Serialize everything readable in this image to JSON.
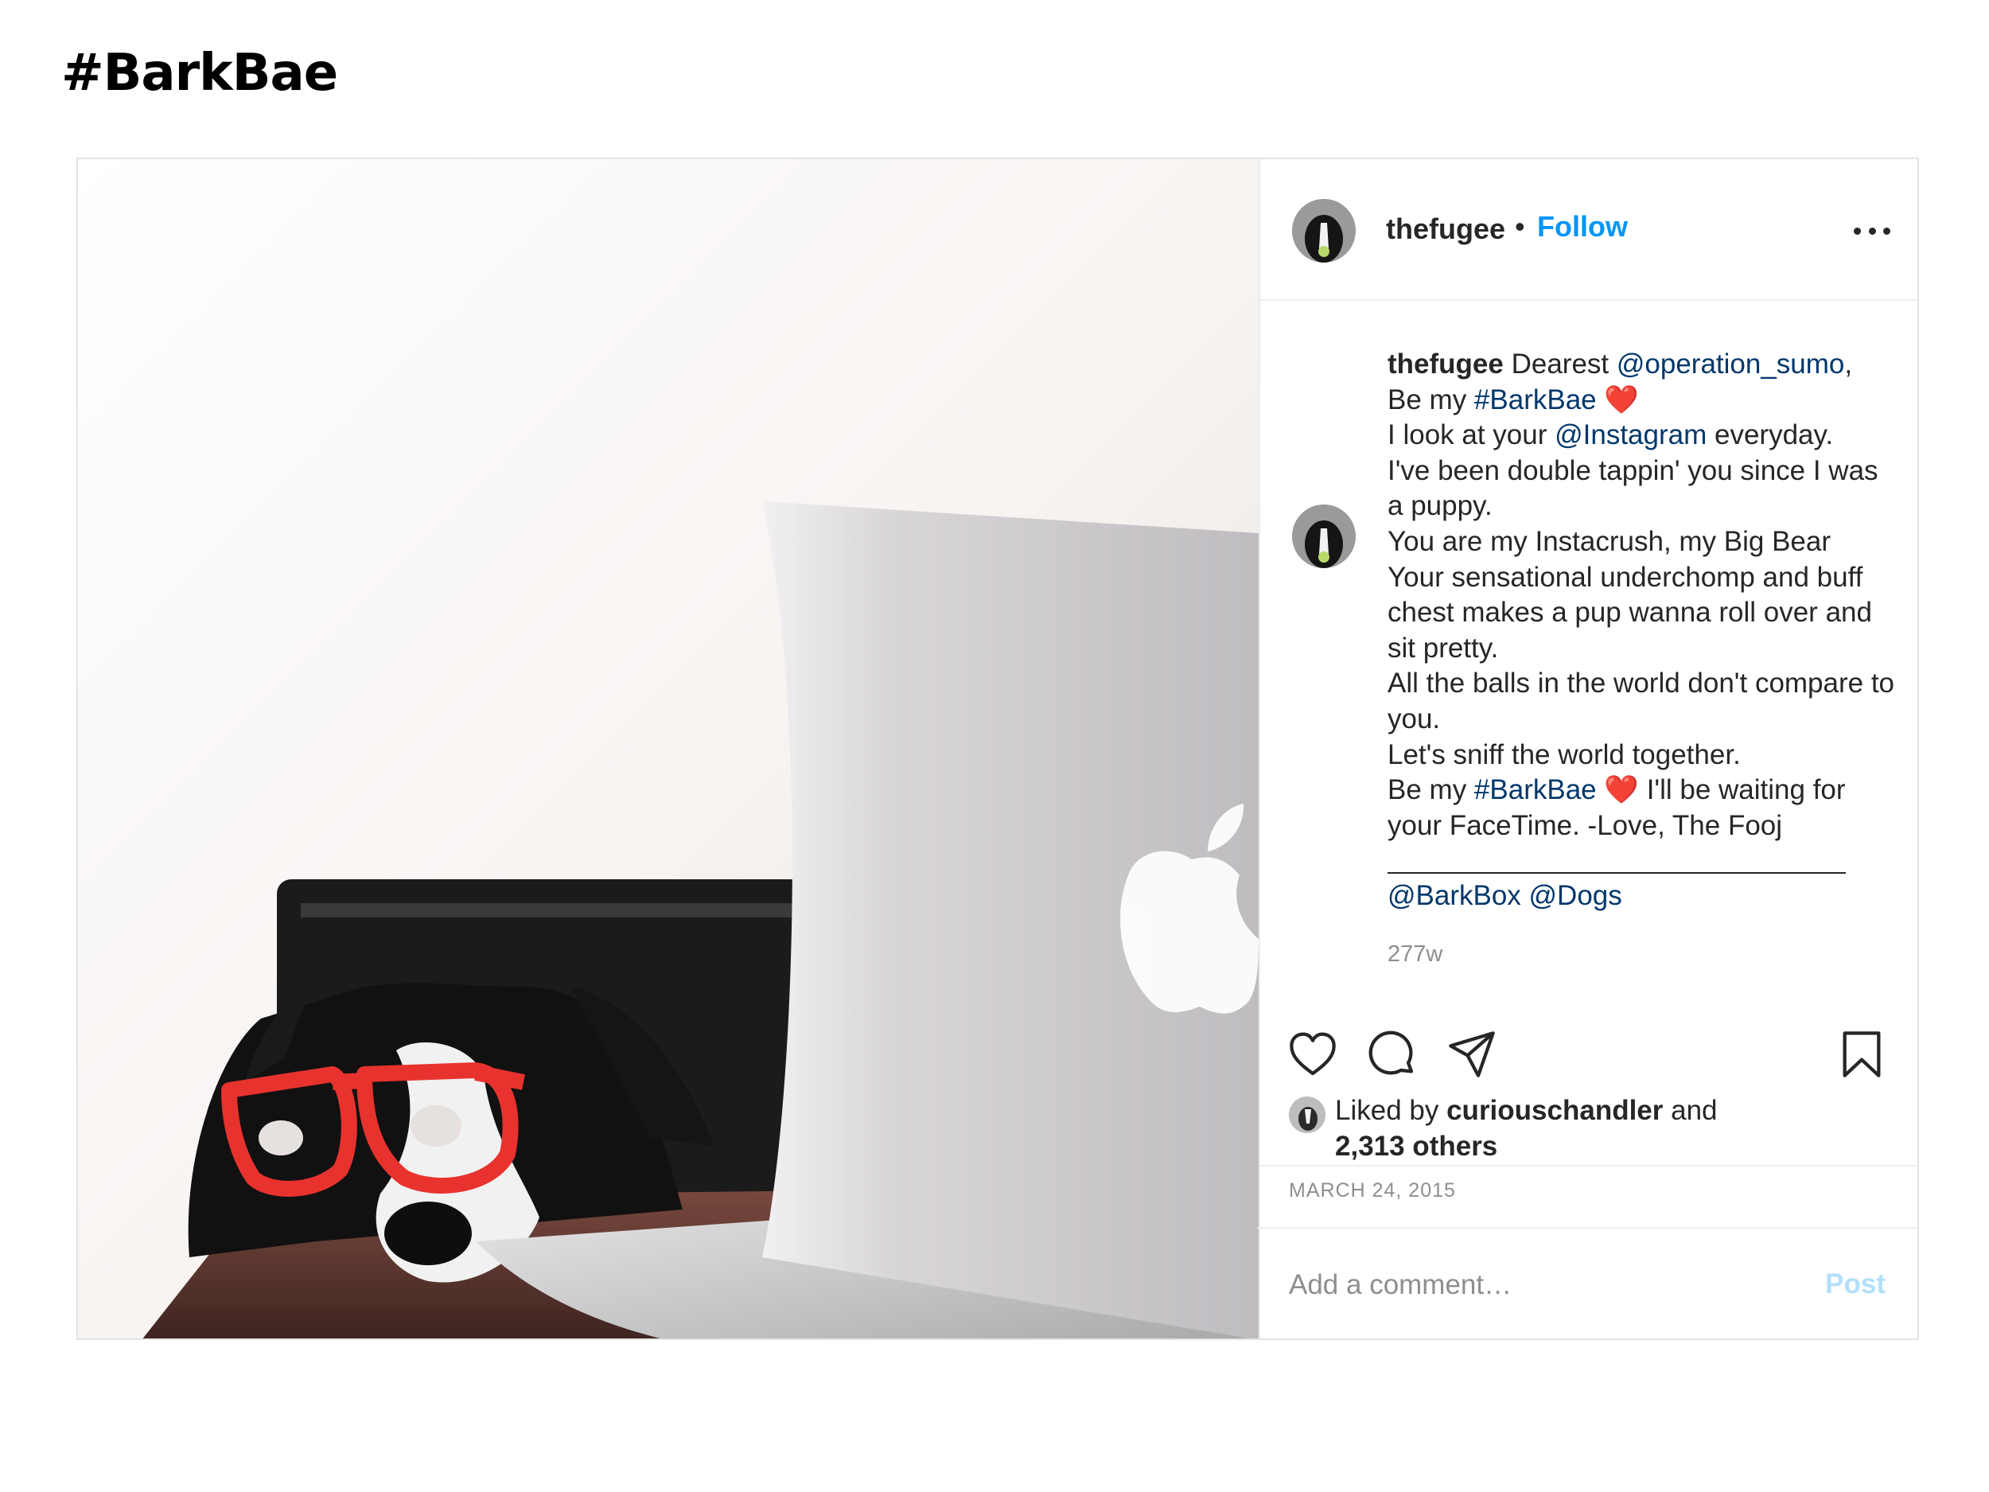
{
  "page": {
    "heading": "#BarkBae"
  },
  "post": {
    "photo_alt": "Dog wearing red glasses resting its chin beside a laptop",
    "header": {
      "username": "thefugee",
      "separator": "•",
      "follow_label": "Follow",
      "more_icon": "more-options-icon"
    },
    "caption": {
      "username": "thefugee",
      "text_1": " Dearest ",
      "mention_1": "@operation_sumo",
      "text_2": ",\nBe my ",
      "hashtag_1": "#BarkBae",
      "emoji_1": "❤️",
      "text_3": "\nI look at your ",
      "mention_2": "@Instagram",
      "text_4": " everyday.\nI've been double tappin' you since I was a puppy.\nYou are my Instacrush, my Big Bear\nYour sensational underchomp and buff chest makes a pup wanna roll over and sit pretty.\nAll the balls in the world don't compare to you.\nLet's sniff the world together.\nBe my ",
      "hashtag_2": "#BarkBae",
      "emoji_2": "❤️",
      "text_5": " I'll be waiting for your FaceTime. -Love, The Fooj",
      "tags": "@BarkBox @Dogs",
      "time_ago": "277w"
    },
    "actions": {
      "like_icon": "heart-icon",
      "comment_icon": "comment-bubble-icon",
      "share_icon": "paper-plane-icon",
      "save_icon": "bookmark-icon"
    },
    "likes": {
      "prefix": "Liked by ",
      "user": "curiouschandler",
      "suffix": " and",
      "others": "2,313 others"
    },
    "date": "MARCH 24, 2015",
    "comment": {
      "placeholder": "Add a comment…",
      "post_label": "Post"
    }
  },
  "colors": {
    "link_blue": "#00376b",
    "follow_blue": "#0095f6",
    "post_button_disabled": "#b2dffc",
    "muted": "#8e8e8e",
    "text": "#262626"
  }
}
